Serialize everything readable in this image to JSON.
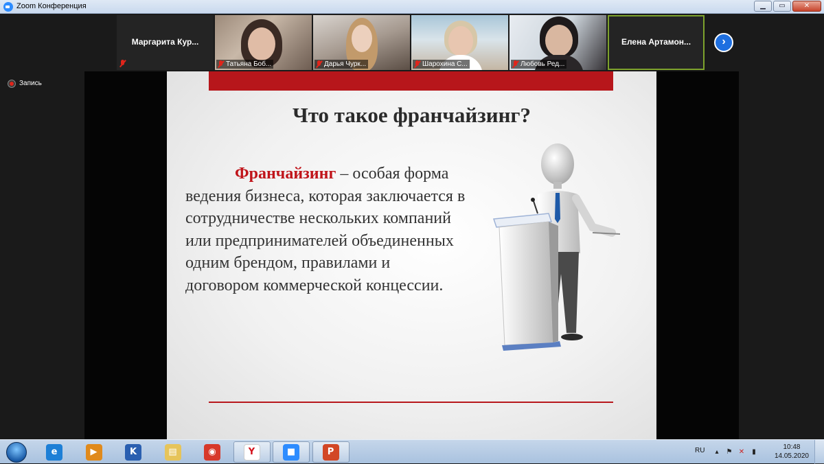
{
  "window": {
    "title": "Zoom Конференция",
    "controls": {
      "minimize": "▁",
      "maximize": "▭",
      "close": "✕"
    }
  },
  "participants": [
    {
      "name": "Маргарита  Кур...",
      "video": false,
      "muted": true
    },
    {
      "name": "Татьяна Боб...",
      "video": true,
      "muted": true
    },
    {
      "name": "Дарья Чурк...",
      "video": true,
      "muted": true
    },
    {
      "name": "Шарохина С...",
      "video": true,
      "muted": true
    },
    {
      "name": "Любовь Ред...",
      "video": true,
      "muted": true
    },
    {
      "name": "Елена  Артамон...",
      "video": false,
      "muted": false,
      "active_speaker": true
    }
  ],
  "next_page_icon": "chevron-right-icon",
  "recording": {
    "label": "Запись"
  },
  "slide": {
    "heading": "Что такое франчайзинг?",
    "term": "Франчайзинг",
    "definition": " – особая форма ведения бизнеса, которая заключается в сотрудничестве нескольких компаний или предпринимателей объединенных одним брендом, правилами и договором коммерческой концессии.",
    "accent_color": "#b7161b"
  },
  "taskbar": {
    "apps": [
      {
        "name": "internet-explorer-icon",
        "glyph": "e",
        "color": "#1d7fd6",
        "open": false
      },
      {
        "name": "media-player-icon",
        "glyph": "▶",
        "color": "#e08a1c",
        "open": false
      },
      {
        "name": "k-meleon-icon",
        "glyph": "K",
        "color": "#2a5fb0",
        "open": false
      },
      {
        "name": "file-explorer-icon",
        "glyph": "▤",
        "color": "#e6c45a",
        "open": false
      },
      {
        "name": "chrome-icon",
        "glyph": "◉",
        "color": "#d7392b",
        "open": false
      },
      {
        "name": "yandex-browser-icon",
        "glyph": "Y",
        "color": "#ffffff",
        "open": true
      },
      {
        "name": "zoom-icon",
        "glyph": "■",
        "color": "#2d8cff",
        "open": true
      },
      {
        "name": "powerpoint-icon",
        "glyph": "P",
        "color": "#d24726",
        "open": true
      }
    ],
    "tray": {
      "language": "RU",
      "time": "10:48",
      "date": "14.05.2020"
    }
  }
}
